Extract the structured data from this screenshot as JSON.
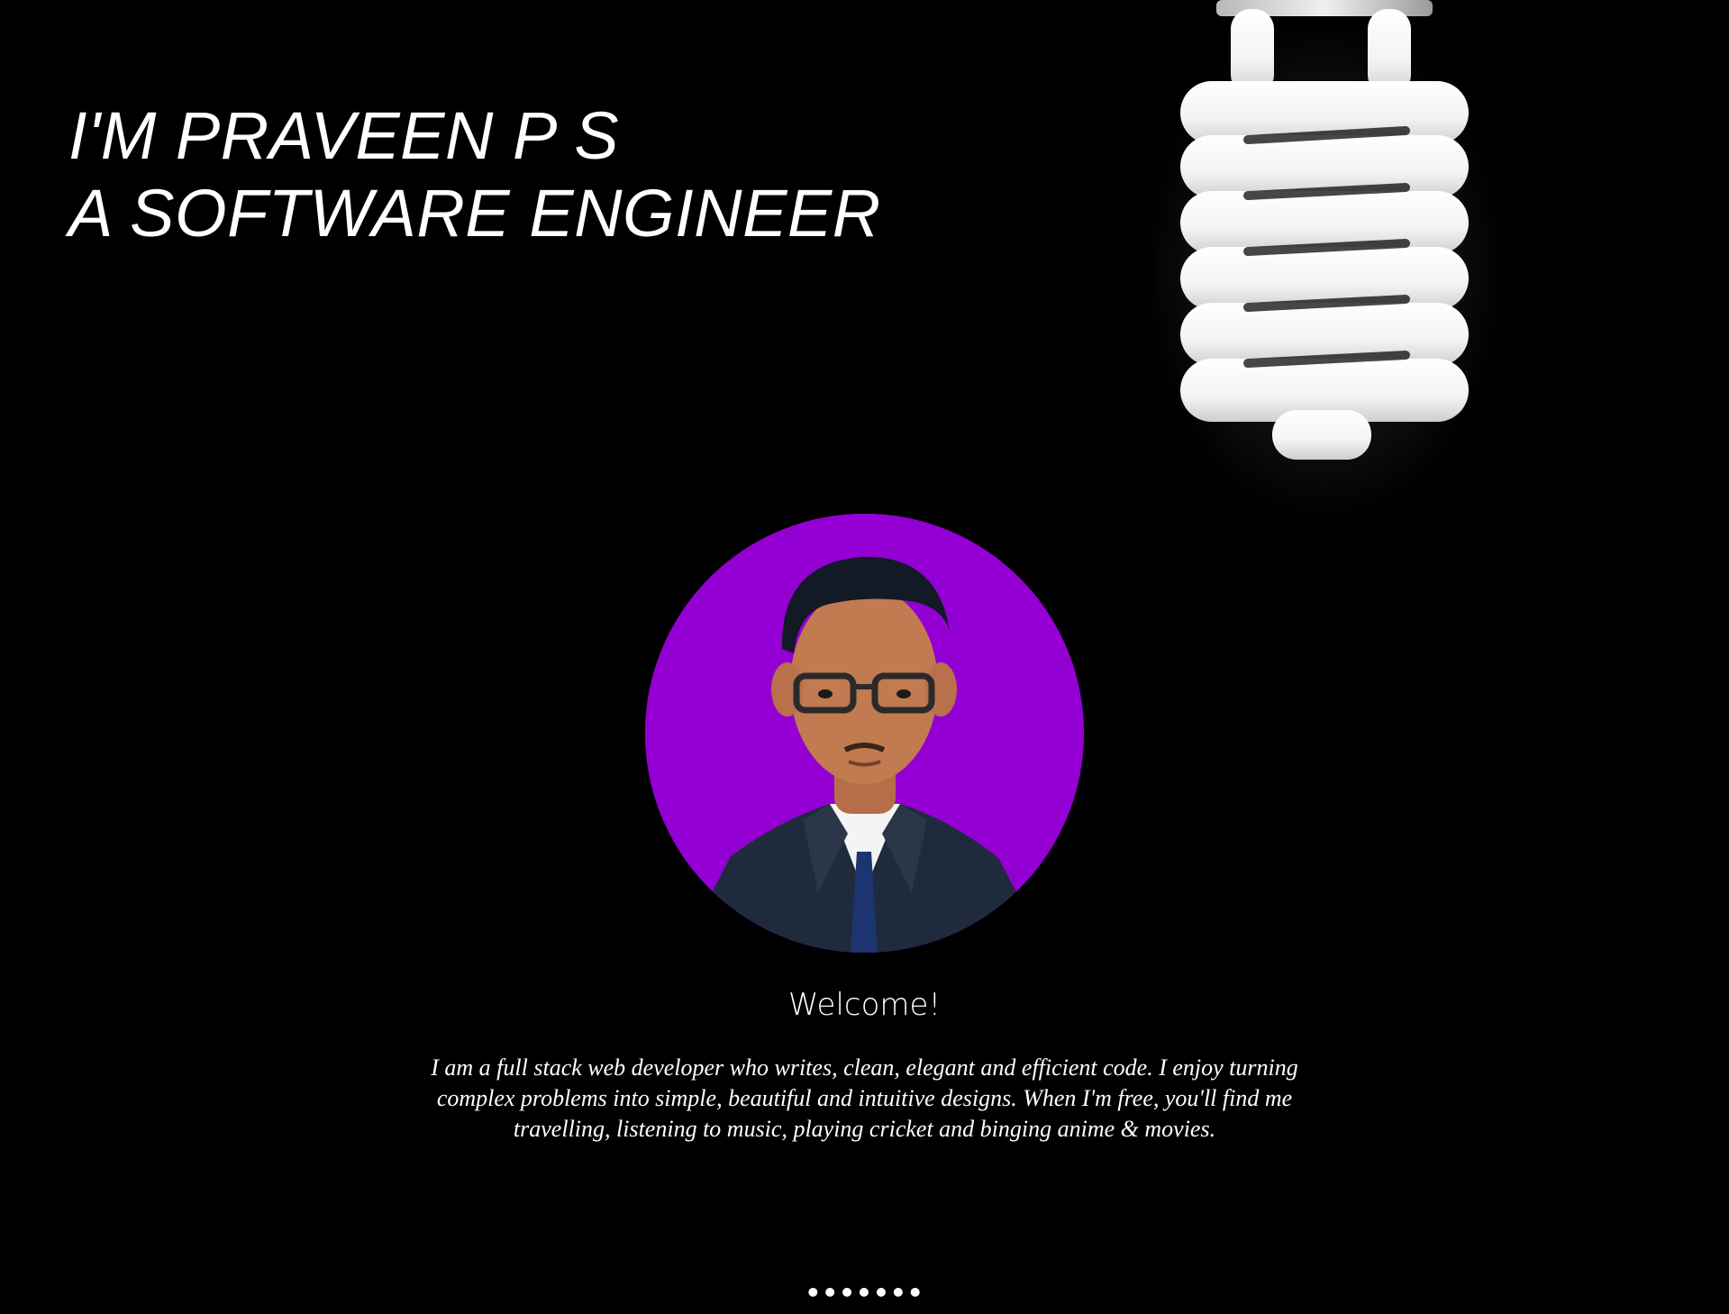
{
  "hero": {
    "line1": "I'M PRAVEEN P S",
    "line2": "A SOFTWARE ENGINEER",
    "background_image": "light-bulb-icon"
  },
  "profile": {
    "photo": "profile-photo",
    "photo_background_color": "#9400d3"
  },
  "intro": {
    "heading": "Welcome!",
    "bio": "I am a full stack web developer who writes, clean, elegant and efficient code. I enjoy turning complex problems into simple, beautiful and intuitive designs. When I'm free, you'll find me travelling, listening to music, playing cricket and binging anime & movies."
  },
  "scroll_indicator": {
    "text": "•••••••"
  },
  "colors": {
    "background": "#000000",
    "text": "#ffffff",
    "accent": "#9400d3"
  }
}
